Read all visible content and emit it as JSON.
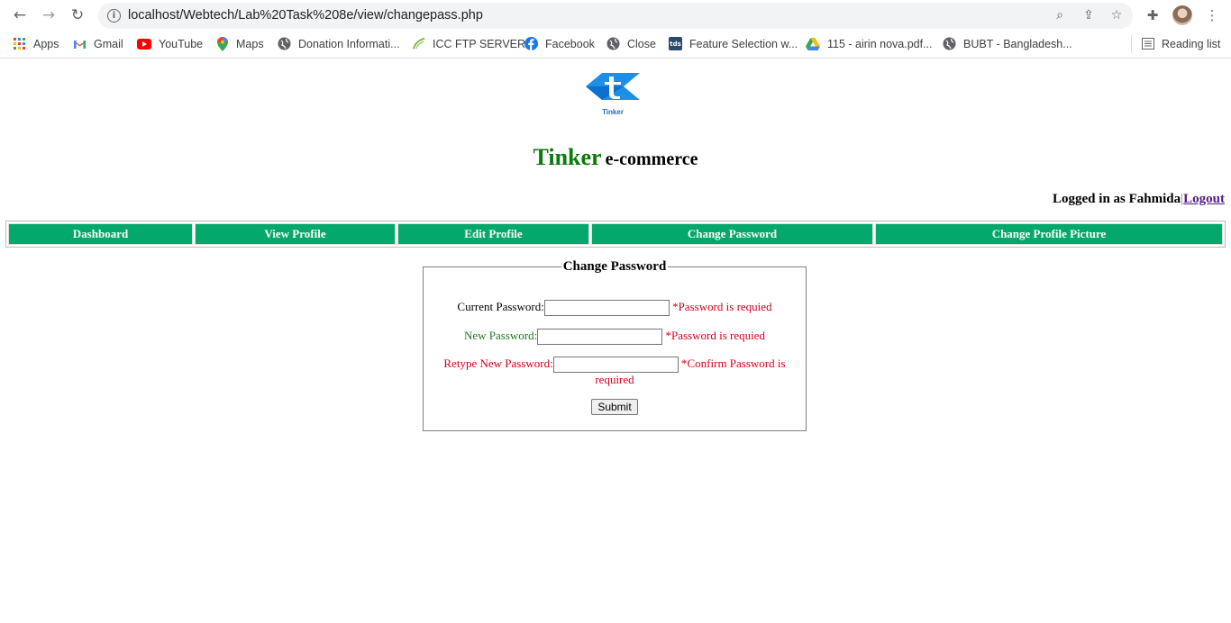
{
  "browser": {
    "url": "localhost/Webtech/Lab%20Task%208e/view/changepass.php",
    "bookmarks": [
      {
        "label": "Apps",
        "icon": "apps-grid-icon"
      },
      {
        "label": "Gmail",
        "icon": "gmail-icon"
      },
      {
        "label": "YouTube",
        "icon": "youtube-icon"
      },
      {
        "label": "Maps",
        "icon": "maps-icon"
      },
      {
        "label": "Donation Informati...",
        "icon": "globe-icon"
      },
      {
        "label": "ICC FTP SERVER",
        "icon": "icc-icon"
      },
      {
        "label": "Facebook",
        "icon": "facebook-icon"
      },
      {
        "label": "Close",
        "icon": "globe-icon"
      },
      {
        "label": "Feature Selection w...",
        "icon": "tds-icon"
      },
      {
        "label": "115 - airin nova.pdf...",
        "icon": "drive-icon"
      },
      {
        "label": "BUBT - Bangladesh...",
        "icon": "globe-icon"
      }
    ],
    "reading_list": "Reading list",
    "tds_badge": "tds"
  },
  "site": {
    "logo_text": "Tinker",
    "title_main": "Tinker",
    "title_sub": "e-commerce",
    "logged_in_text": "Logged in as Fahmida",
    "separator": "|",
    "logout_label": "Logout"
  },
  "nav": {
    "items": [
      "Dashboard",
      "View Profile",
      "Edit Profile",
      "Change Password",
      "Change Profile Picture"
    ]
  },
  "form": {
    "legend": "Change Password",
    "current_label": "Current Password:",
    "current_error": "*Password is requied",
    "new_label": "New Password:",
    "new_error": "*Password is requied",
    "retype_label": "Retype New Password:",
    "retype_error_line1": "*Confirm Password is",
    "retype_error_line2": "required",
    "submit_label": "Submit"
  },
  "colors": {
    "nav_bg": "#04a86a",
    "title_green": "#0a7a0a",
    "error_red": "#d0021b",
    "label_green": "#1f7a1f"
  }
}
